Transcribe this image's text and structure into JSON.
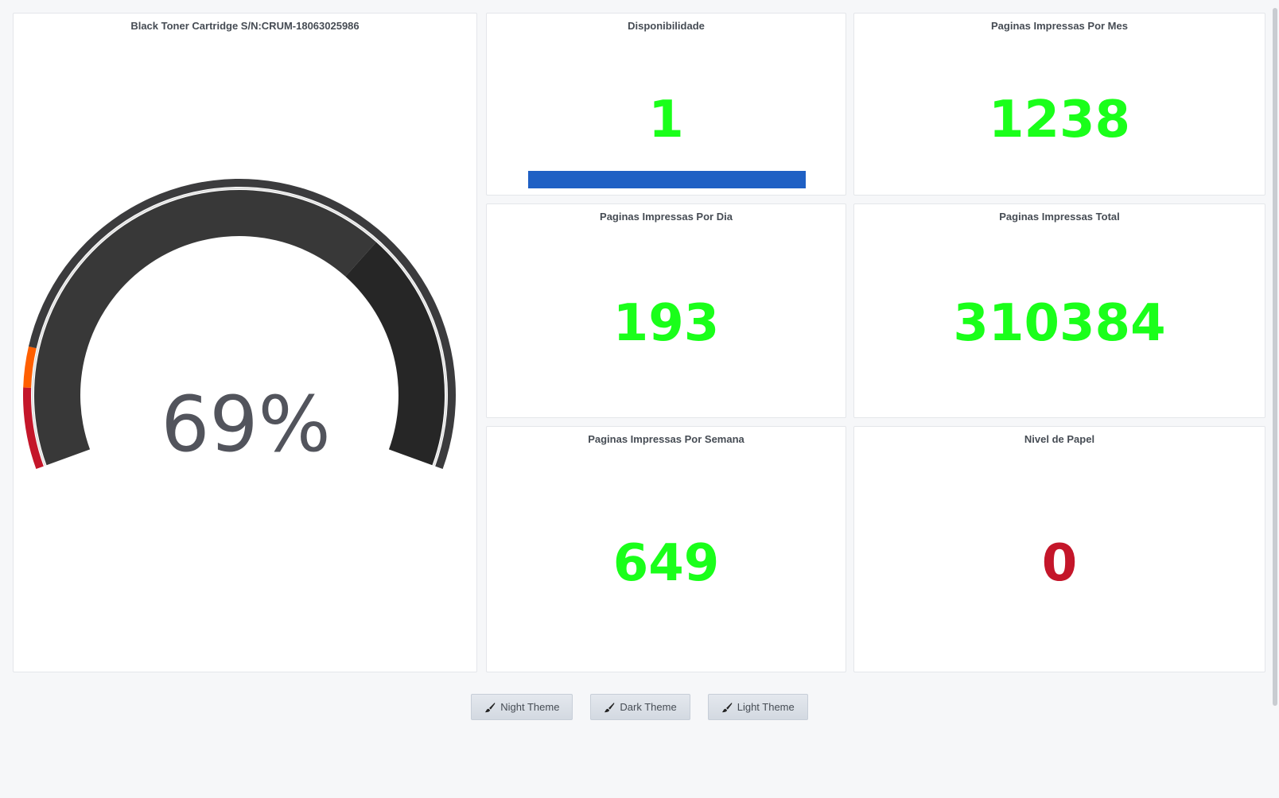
{
  "gauge": {
    "title": "Black Toner Cartridge S/N:CRUM-18063025986",
    "value": 69,
    "display": "69%",
    "min": 0,
    "max": 100,
    "colors": {
      "track": "#383838",
      "empty": "#262626",
      "outer": "#3b3b3d",
      "warning": "#ff5f00",
      "critical": "#c4162a",
      "text": "#52545c"
    },
    "thresholds": [
      {
        "from": 0,
        "to": 10,
        "color": "#c4162a"
      },
      {
        "from": 10,
        "to": 15,
        "color": "#ff5f00"
      },
      {
        "from": 15,
        "to": 100,
        "color": "#3b3b3d"
      }
    ]
  },
  "panels": {
    "disponibilidade": {
      "title": "Disponibilidade",
      "value": "1",
      "bar_fraction": 1,
      "bar_color": "#1f60c4",
      "color": "#1aff1a"
    },
    "por_mes": {
      "title": "Paginas Impressas Por Mes",
      "value": "1238",
      "color": "#1aff1a"
    },
    "por_dia": {
      "title": "Paginas Impressas Por Dia",
      "value": "193",
      "color": "#1aff1a"
    },
    "total": {
      "title": "Paginas Impressas Total",
      "value": "310384",
      "color": "#1aff1a"
    },
    "por_semana": {
      "title": "Paginas Impressas Por Semana",
      "value": "649",
      "color": "#1aff1a"
    },
    "nivel_papel": {
      "title": "Nivel de Papel",
      "value": "0",
      "color": "#c4162a"
    }
  },
  "buttons": [
    {
      "label": "Night Theme",
      "icon": "paintbrush-icon"
    },
    {
      "label": "Dark Theme",
      "icon": "paintbrush-icon"
    },
    {
      "label": "Light Theme",
      "icon": "paintbrush-icon"
    }
  ]
}
